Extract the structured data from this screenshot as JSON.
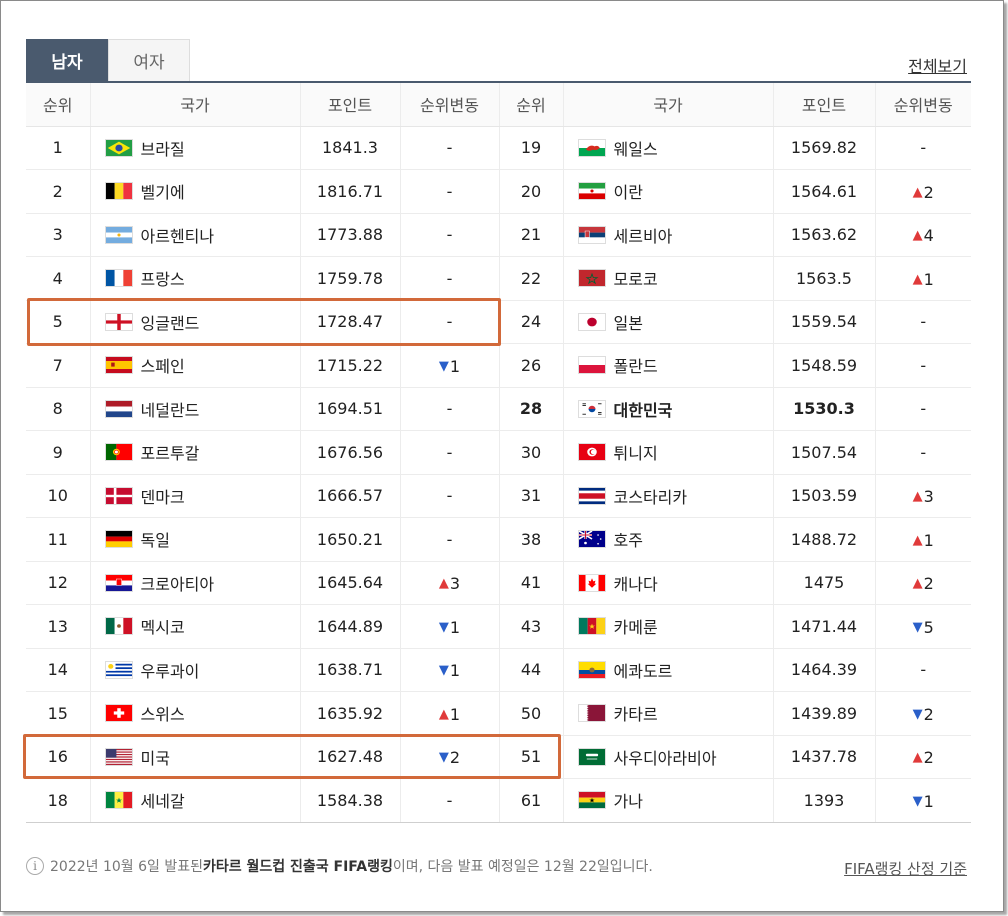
{
  "tabs": [
    {
      "label": "남자",
      "active": true
    },
    {
      "label": "여자",
      "active": false
    }
  ],
  "view_all_label": "전체보기",
  "columns": [
    "순위",
    "국가",
    "포인트",
    "순위변동",
    "순위",
    "국가",
    "포인트",
    "순위변동"
  ],
  "rows": [
    [
      {
        "rank": "1",
        "country": "브라질",
        "flag": "brazil",
        "points": "1841.3",
        "change": "-",
        "dir": "none"
      },
      {
        "rank": "19",
        "country": "웨일스",
        "flag": "wales",
        "points": "1569.82",
        "change": "-",
        "dir": "none"
      }
    ],
    [
      {
        "rank": "2",
        "country": "벨기에",
        "flag": "belgium",
        "points": "1816.71",
        "change": "-",
        "dir": "none"
      },
      {
        "rank": "20",
        "country": "이란",
        "flag": "iran",
        "points": "1564.61",
        "change": "2",
        "dir": "up"
      }
    ],
    [
      {
        "rank": "3",
        "country": "아르헨티나",
        "flag": "argentina",
        "points": "1773.88",
        "change": "-",
        "dir": "none"
      },
      {
        "rank": "21",
        "country": "세르비아",
        "flag": "serbia",
        "points": "1563.62",
        "change": "4",
        "dir": "up"
      }
    ],
    [
      {
        "rank": "4",
        "country": "프랑스",
        "flag": "france",
        "points": "1759.78",
        "change": "-",
        "dir": "none"
      },
      {
        "rank": "22",
        "country": "모로코",
        "flag": "morocco",
        "points": "1563.5",
        "change": "1",
        "dir": "up"
      }
    ],
    [
      {
        "rank": "5",
        "country": "잉글랜드",
        "flag": "england",
        "points": "1728.47",
        "change": "-",
        "dir": "none"
      },
      {
        "rank": "24",
        "country": "일본",
        "flag": "japan",
        "points": "1559.54",
        "change": "-",
        "dir": "none"
      }
    ],
    [
      {
        "rank": "7",
        "country": "스페인",
        "flag": "spain",
        "points": "1715.22",
        "change": "1",
        "dir": "down"
      },
      {
        "rank": "26",
        "country": "폴란드",
        "flag": "poland",
        "points": "1548.59",
        "change": "-",
        "dir": "none"
      }
    ],
    [
      {
        "rank": "8",
        "country": "네덜란드",
        "flag": "netherlands",
        "points": "1694.51",
        "change": "-",
        "dir": "none"
      },
      {
        "rank": "28",
        "country": "대한민국",
        "flag": "korea",
        "points": "1530.3",
        "change": "-",
        "dir": "none",
        "bold": true
      }
    ],
    [
      {
        "rank": "9",
        "country": "포르투갈",
        "flag": "portugal",
        "points": "1676.56",
        "change": "-",
        "dir": "none"
      },
      {
        "rank": "30",
        "country": "튀니지",
        "flag": "tunisia",
        "points": "1507.54",
        "change": "-",
        "dir": "none"
      }
    ],
    [
      {
        "rank": "10",
        "country": "덴마크",
        "flag": "denmark",
        "points": "1666.57",
        "change": "-",
        "dir": "none"
      },
      {
        "rank": "31",
        "country": "코스타리카",
        "flag": "costarica",
        "points": "1503.59",
        "change": "3",
        "dir": "up"
      }
    ],
    [
      {
        "rank": "11",
        "country": "독일",
        "flag": "germany",
        "points": "1650.21",
        "change": "-",
        "dir": "none"
      },
      {
        "rank": "38",
        "country": "호주",
        "flag": "australia",
        "points": "1488.72",
        "change": "1",
        "dir": "up"
      }
    ],
    [
      {
        "rank": "12",
        "country": "크로아티아",
        "flag": "croatia",
        "points": "1645.64",
        "change": "3",
        "dir": "up"
      },
      {
        "rank": "41",
        "country": "캐나다",
        "flag": "canada",
        "points": "1475",
        "change": "2",
        "dir": "up"
      }
    ],
    [
      {
        "rank": "13",
        "country": "멕시코",
        "flag": "mexico",
        "points": "1644.89",
        "change": "1",
        "dir": "down"
      },
      {
        "rank": "43",
        "country": "카메룬",
        "flag": "cameroon",
        "points": "1471.44",
        "change": "5",
        "dir": "down"
      }
    ],
    [
      {
        "rank": "14",
        "country": "우루과이",
        "flag": "uruguay",
        "points": "1638.71",
        "change": "1",
        "dir": "down"
      },
      {
        "rank": "44",
        "country": "에콰도르",
        "flag": "ecuador",
        "points": "1464.39",
        "change": "-",
        "dir": "none"
      }
    ],
    [
      {
        "rank": "15",
        "country": "스위스",
        "flag": "switzerland",
        "points": "1635.92",
        "change": "1",
        "dir": "up"
      },
      {
        "rank": "50",
        "country": "카타르",
        "flag": "qatar",
        "points": "1439.89",
        "change": "2",
        "dir": "down"
      }
    ],
    [
      {
        "rank": "16",
        "country": "미국",
        "flag": "usa",
        "points": "1627.48",
        "change": "2",
        "dir": "down"
      },
      {
        "rank": "51",
        "country": "사우디아라비아",
        "flag": "saudi",
        "points": "1437.78",
        "change": "2",
        "dir": "up"
      }
    ],
    [
      {
        "rank": "18",
        "country": "세네갈",
        "flag": "senegal",
        "points": "1584.38",
        "change": "-",
        "dir": "none"
      },
      {
        "rank": "61",
        "country": "가나",
        "flag": "ghana",
        "points": "1393",
        "change": "1",
        "dir": "down"
      }
    ]
  ],
  "footer": {
    "prefix": "2022년 10월 6일 발표된 ",
    "bold": "카타르 월드컵 진출국 FIFA랭킹",
    "suffix": "이며, 다음 발표 예정일은 12월 22일입니다.",
    "criteria_label": "FIFA랭킹 산정 기준"
  },
  "colors": {
    "accent": "#4a5a6e",
    "highlight": "#d2693a",
    "up": "#e03a3a",
    "down": "#2a5fc9"
  }
}
